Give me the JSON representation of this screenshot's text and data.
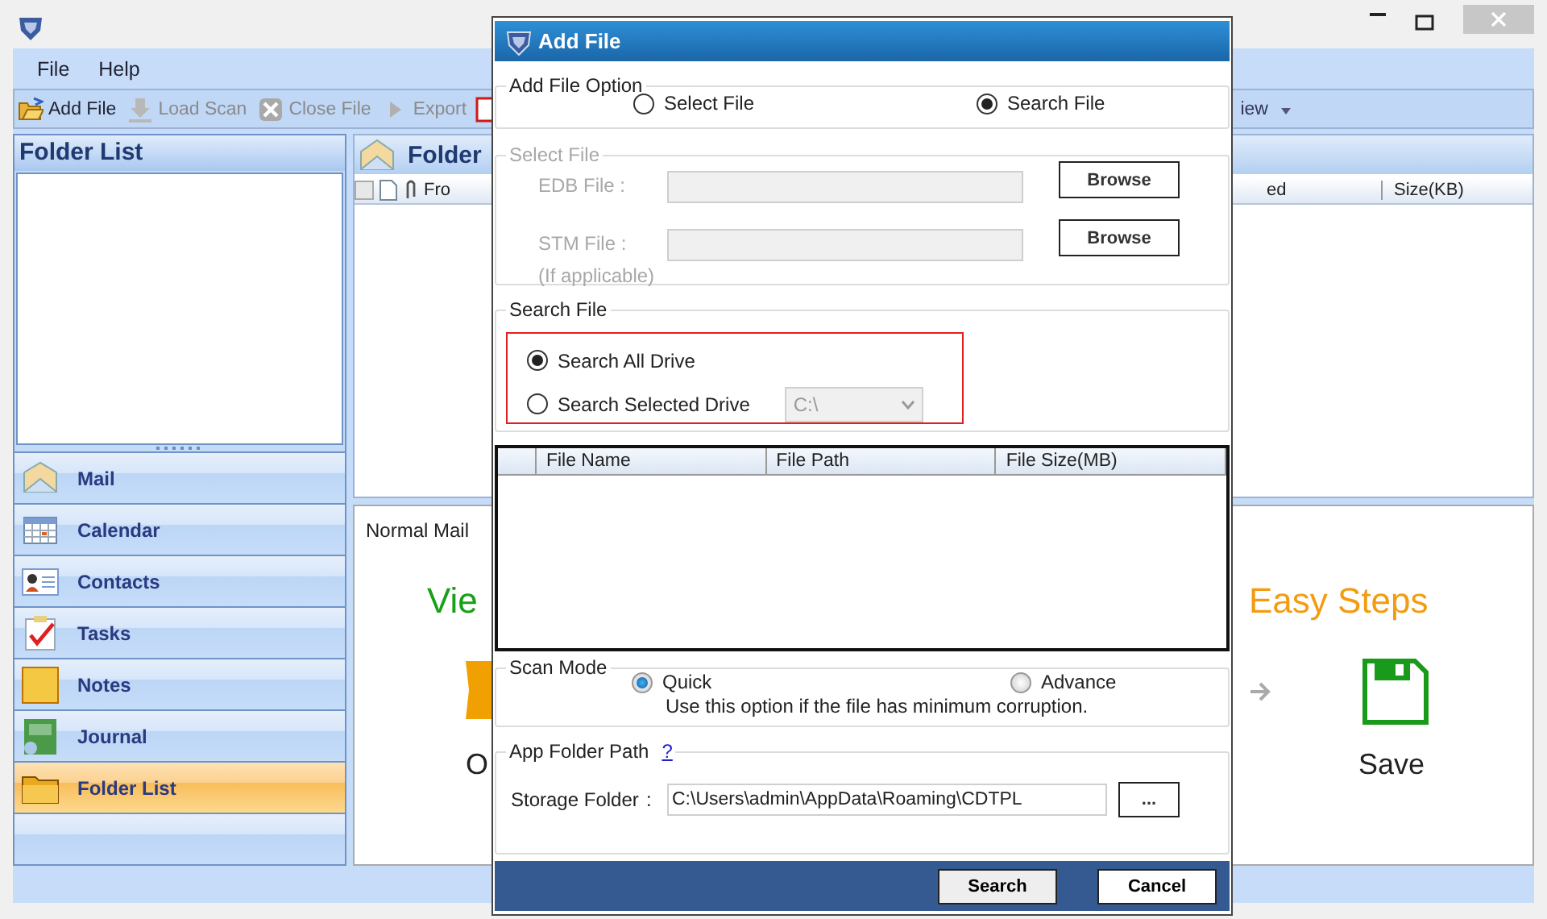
{
  "app": {
    "menu": [
      "File",
      "Help"
    ],
    "toolbar": [
      {
        "label": "Add File",
        "kind": "add",
        "disabled": false
      },
      {
        "label": "Load Scan",
        "kind": "load",
        "disabled": true
      },
      {
        "label": "Close File",
        "kind": "close",
        "disabled": true
      },
      {
        "label": "Export",
        "kind": "export",
        "disabled": true
      }
    ],
    "view_menu": "iew",
    "sidebar": {
      "title": "Folder List",
      "items": [
        {
          "label": "Mail",
          "kind": "mail",
          "selected": false
        },
        {
          "label": "Calendar",
          "kind": "calendar",
          "selected": false
        },
        {
          "label": "Contacts",
          "kind": "contacts",
          "selected": false
        },
        {
          "label": "Tasks",
          "kind": "tasks",
          "selected": false
        },
        {
          "label": "Notes",
          "kind": "notes",
          "selected": false
        },
        {
          "label": "Journal",
          "kind": "journal",
          "selected": false
        },
        {
          "label": "Folder List",
          "kind": "folders",
          "selected": true
        }
      ]
    },
    "folder_pane": {
      "title": "Folder",
      "columns": [
        "Fro",
        "ed",
        "Size(KB)"
      ]
    },
    "preview": {
      "tab": "Normal Mail",
      "heading_left": "Vie",
      "heading_right": "Easy Steps",
      "step_left": "O",
      "step_right": "Save"
    }
  },
  "dialog": {
    "title": "Add File",
    "add_file_option": {
      "legend": "Add File Option",
      "options": [
        {
          "label": "Select File",
          "selected": false
        },
        {
          "label": "Search File",
          "selected": true
        }
      ]
    },
    "select_file": {
      "legend": "Select File",
      "disabled": true,
      "rows": [
        {
          "label": "EDB File :",
          "note": null,
          "button": "Browse"
        },
        {
          "label": "STM File :",
          "note": "(If applicable)",
          "button": "Browse"
        }
      ]
    },
    "search_file": {
      "legend": "Search File",
      "options": [
        {
          "label": "Search All Drive",
          "selected": true
        },
        {
          "label": "Search Selected Drive",
          "selected": false
        }
      ],
      "drive": {
        "value": "C:\\",
        "disabled": true
      }
    },
    "table": {
      "columns": [
        "File Name",
        "File Path",
        "File Size(MB)"
      ]
    },
    "scan_mode": {
      "legend": "Scan Mode",
      "options": [
        {
          "label": "Quick",
          "selected": true
        },
        {
          "label": "Advance",
          "selected": false
        }
      ],
      "hint": "Use this option if the file has minimum corruption."
    },
    "app_folder": {
      "legend": "App Folder Path",
      "help": "?",
      "label": "Storage Folder",
      "separator": ":",
      "value": "C:\\Users\\admin\\AppData\\Roaming\\CDTPL",
      "browse": "..."
    },
    "buttons": [
      {
        "label": "Search",
        "kind": "primary"
      },
      {
        "label": "Cancel",
        "kind": "secondary"
      }
    ]
  }
}
